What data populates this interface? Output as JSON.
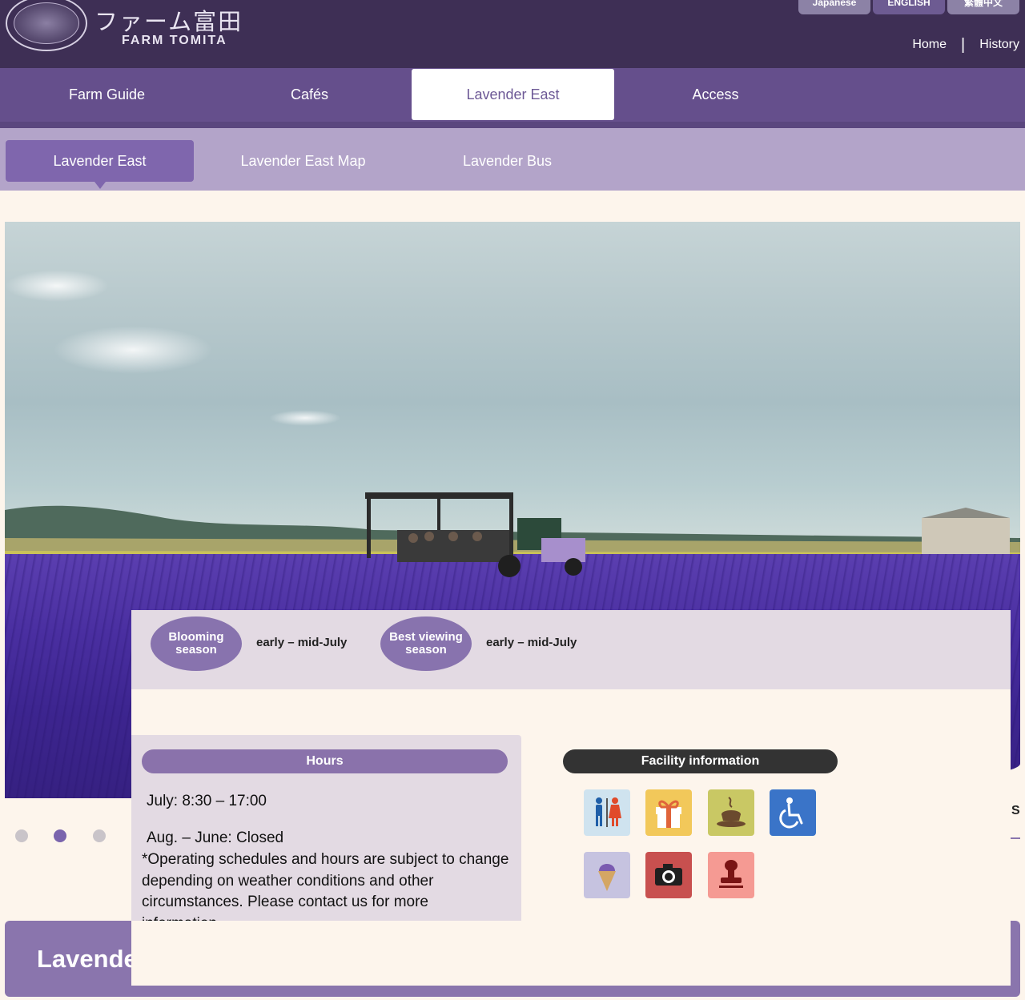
{
  "header": {
    "logo_jp": "ファーム富田",
    "logo_en": "FARM TOMITA",
    "languages": [
      "Japanese",
      "ENGLISH",
      "繁體中文"
    ],
    "top_links": [
      "Home",
      "History"
    ],
    "separator": "|"
  },
  "main_nav": {
    "tabs": [
      {
        "label": "Farm Guide"
      },
      {
        "label": "Cafés"
      },
      {
        "label": "Lavender East",
        "active": true
      },
      {
        "label": "Access"
      }
    ]
  },
  "sub_nav": {
    "tabs": [
      {
        "label": "Lavender East",
        "active": true
      },
      {
        "label": "Lavender East Map"
      },
      {
        "label": "Lavender Bus"
      }
    ]
  },
  "slider": {
    "total_slides": 3,
    "active_index": 2
  },
  "season": {
    "blooming_label": "Blooming season",
    "blooming_value": "early – mid-July",
    "best_label": "Best viewing season",
    "best_value": "early – mid-July"
  },
  "hours": {
    "title": "Hours",
    "line1": "July: 8:30 – 17:00",
    "line2": "Aug. – June: Closed",
    "note": "*Operating schedules and hours are subject to change depending on weather conditions and other circumstances. Please contact us for more information."
  },
  "facilities": {
    "title": "Facility information",
    "icons": [
      "restroom-icon",
      "gift-shop-icon",
      "cafe-icon",
      "wheelchair-icon",
      "soft-serve-icon",
      "camera-icon",
      "stamp-icon"
    ]
  },
  "bottom": {
    "title": "Lavende"
  },
  "right_edge": {
    "letter": "S"
  },
  "colors": {
    "header_bg": "#3e2f55",
    "nav_bg": "#654f8c",
    "subnav_bg": "#b3a4c9",
    "accent": "#8a72ab"
  }
}
